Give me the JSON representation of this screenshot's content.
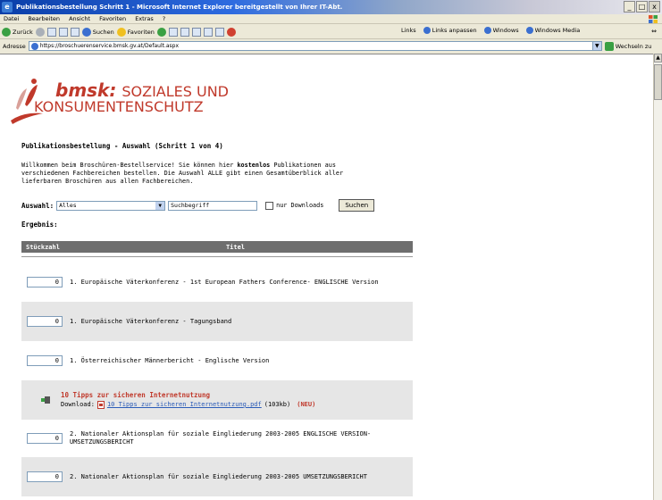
{
  "window": {
    "title": "Publikationsbestellung Schritt 1 - Microsoft Internet Explorer bereitgestellt von Ihrer IT-Abt.",
    "buttons": [
      "_",
      "□",
      "x"
    ]
  },
  "menu": [
    "Datei",
    "Bearbeiten",
    "Ansicht",
    "Favoriten",
    "Extras",
    "?"
  ],
  "toolbar": {
    "back": "Zurück",
    "search": "Suchen",
    "favorites": "Favoriten",
    "links_label": "Links",
    "links": [
      "Links anpassen",
      "Windows",
      "Windows Media"
    ]
  },
  "address": {
    "label": "Adresse",
    "url": "https://broschuerenservice.bmsk.gv.at/Default.aspx",
    "go": "Wechseln zu"
  },
  "logo": {
    "brand": "bmsk:",
    "line1": "SOZIALES UND",
    "line2": "KONSUMENTENSCHUTZ"
  },
  "page": {
    "heading": "Publikationsbestellung - Auswahl (Schritt 1 von 4)",
    "intro_a": "Willkommen beim Broschüren-Bestellservice! Sie können hier ",
    "intro_bold": "kostenlos",
    "intro_b": " Publikationen aus verschiedenen Fachbereichen bestellen. Die Auswahl ALLE gibt einen Gesamtüberblick aller lieferbaren Broschüren aus allen Fachbereichen.",
    "auswahl_label": "Auswahl:",
    "auswahl_value": "Alles",
    "search_value": "Suchbegriff",
    "only_downloads": "nur Downloads",
    "search_button": "Suchen",
    "ergebnis": "Ergebnis:",
    "col_qty": "Stückzahl",
    "col_title": "Titel"
  },
  "rows": [
    {
      "qty": "0",
      "title": "1. Europäische Väterkonferenz - 1st European Fathers Conference- ENGLISCHE Version"
    },
    {
      "qty": "0",
      "title": "1. Europäische Väterkonferenz - Tagungsband"
    },
    {
      "qty": "0",
      "title": "1. Österreichischer Männerbericht - Englische Version"
    },
    {
      "download": true,
      "title": "10 Tipps zur sicheren Internetnutzung",
      "dl_label": "Download:",
      "dl_link": "10 Tipps zur sicheren Internetnutzung.pdf",
      "dl_size": "(103kb)",
      "dl_new": "(NEU)"
    },
    {
      "qty": "0",
      "title1": "2. Nationaler Aktionsplan für soziale Eingliederung 2003-2005 ENGLISCHE VERSION-",
      "title2": "UMSETZUNGSBERICHT"
    },
    {
      "qty": "0",
      "title": "2. Nationaler Aktionsplan für soziale Eingliederung 2003-2005 UMSETZUNGSBERICHT"
    }
  ]
}
